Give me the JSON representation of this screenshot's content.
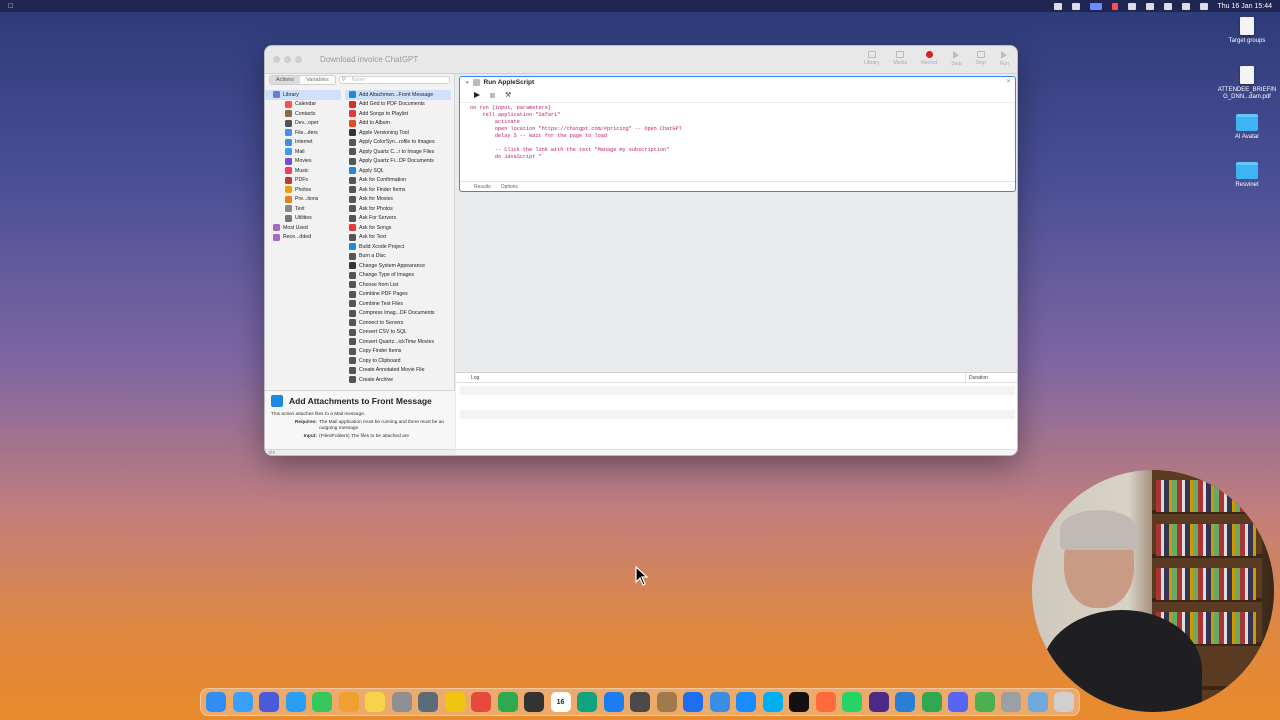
{
  "menubar": {
    "datetime": "Thu 16 Jan 15:44"
  },
  "desktop_icons": [
    {
      "label": "Target groups",
      "kind": "doc"
    },
    {
      "label": "ATTENDEE_BRIEFING_DNN...dam.pdf",
      "kind": "doc"
    },
    {
      "label": "AI Avatar",
      "kind": "folder"
    },
    {
      "label": "Resvinet",
      "kind": "folder"
    }
  ],
  "window": {
    "title": "Download invoice ChatGPT",
    "toolbar": [
      "Library",
      "Media",
      "Record",
      "Step",
      "Stop",
      "Run"
    ],
    "tabs": {
      "actions": "Actions",
      "variables": "Variables"
    },
    "search_placeholder": "Name",
    "categories": [
      {
        "label": "Library",
        "child": false
      },
      {
        "label": "Calendar",
        "child": true
      },
      {
        "label": "Contacts",
        "child": true
      },
      {
        "label": "Dev...oper",
        "child": true
      },
      {
        "label": "File...ders",
        "child": true
      },
      {
        "label": "Internet",
        "child": true
      },
      {
        "label": "Mail",
        "child": true
      },
      {
        "label": "Movies",
        "child": true
      },
      {
        "label": "Music",
        "child": true
      },
      {
        "label": "PDFs",
        "child": true
      },
      {
        "label": "Photos",
        "child": true
      },
      {
        "label": "Pre...tions",
        "child": true
      },
      {
        "label": "Text",
        "child": true
      },
      {
        "label": "Utilities",
        "child": true
      },
      {
        "label": "Most Used",
        "child": false
      },
      {
        "label": "Rece...dded",
        "child": false
      }
    ],
    "actions": [
      "Add Attachmen...Front Message",
      "Add Grid to PDF Documents",
      "Add Songs to Playlist",
      "Add to Album",
      "Apple Versioning Tool",
      "Apply ColorSyn...rofile to Images",
      "Apply Quartz C...r to Image Files",
      "Apply Quartz Fi...DF Documents",
      "Apply SQL",
      "Ask for Confirmation",
      "Ask for Finder Items",
      "Ask for Movies",
      "Ask for Photos",
      "Ask For Servers",
      "Ask for Songs",
      "Ask for Text",
      "Build Xcode Project",
      "Burn a Disc",
      "Change System Appearance",
      "Change Type of Images",
      "Choose from List",
      "Combine PDF Pages",
      "Combine Text Files",
      "Compress Imag...DF Documents",
      "Connect to Servers",
      "Convert CSV to SQL",
      "Convert Quartz...ickTime Movies",
      "Copy Finder Items",
      "Copy to Clipboard",
      "Create Annotated Movie File",
      "Create Archive"
    ],
    "description": {
      "title": "Add Attachments to Front Message",
      "text": "This action attaches files to a Mail message.",
      "requires_label": "Requires:",
      "requires": "The Mail application must be running and there must be an outgoing message.",
      "input_label": "Input:",
      "input": "(Files/Folders) The files to be attached are"
    },
    "action_card": {
      "title": "Run AppleScript",
      "code": [
        "on run {input, parameters}",
        "    tell application \"Safari\"",
        "        activate",
        "        open location \"https://chatgpt.com/#pricing\" -- Open ChatGPT",
        "        delay 5 -- Wait for the page to load",
        "",
        "        -- Click the link with the text \"Manage my subscription\"",
        "        do JavaScript \""
      ],
      "tabs": [
        "Results",
        "Options"
      ]
    },
    "log": {
      "col_log": "Log",
      "col_duration": "Duration"
    }
  },
  "dock": [
    {
      "name": "finder",
      "color": "#2f8df5"
    },
    {
      "name": "mail",
      "color": "#3aa0ff"
    },
    {
      "name": "todo",
      "color": "#4a5bd9"
    },
    {
      "name": "safari",
      "color": "#2a9df4"
    },
    {
      "name": "messages",
      "color": "#34c759"
    },
    {
      "name": "photos",
      "color": "#f0a030"
    },
    {
      "name": "notes",
      "color": "#f7d34a"
    },
    {
      "name": "system-settings",
      "color": "#8e8e93"
    },
    {
      "name": "automator",
      "color": "#5b6b7a"
    },
    {
      "name": "tes",
      "color": "#f1c40f"
    },
    {
      "name": "chrome",
      "color": "#e64a3b"
    },
    {
      "name": "numbers",
      "color": "#2fa84f"
    },
    {
      "name": "calculator",
      "color": "#333333"
    },
    {
      "name": "calendar",
      "color": "#ffffff"
    },
    {
      "name": "chatgpt",
      "color": "#10a37f"
    },
    {
      "name": "xcode",
      "color": "#1c7cf4"
    },
    {
      "name": "sublime",
      "color": "#4a4a4a"
    },
    {
      "name": "archive",
      "color": "#a07a4a"
    },
    {
      "name": "vpn",
      "color": "#1e6ef0"
    },
    {
      "name": "preview",
      "color": "#3a8ee6"
    },
    {
      "name": "app-store",
      "color": "#1a8cff"
    },
    {
      "name": "skype",
      "color": "#00aff0"
    },
    {
      "name": "capcut",
      "color": "#111111"
    },
    {
      "name": "clock",
      "color": "#ff6a3d"
    },
    {
      "name": "whatsapp",
      "color": "#25d366"
    },
    {
      "name": "app2",
      "color": "#4b2a8a"
    },
    {
      "name": "tools",
      "color": "#2a7fd4"
    },
    {
      "name": "charts",
      "color": "#2fa84f"
    },
    {
      "name": "discord",
      "color": "#5865f2"
    },
    {
      "name": "maps",
      "color": "#4caf50"
    },
    {
      "name": "script-editor",
      "color": "#9aa0a6"
    },
    {
      "name": "downloads",
      "color": "#6fa8dc"
    },
    {
      "name": "trash",
      "color": "#d0d0d0"
    }
  ],
  "calendar_day": "16"
}
